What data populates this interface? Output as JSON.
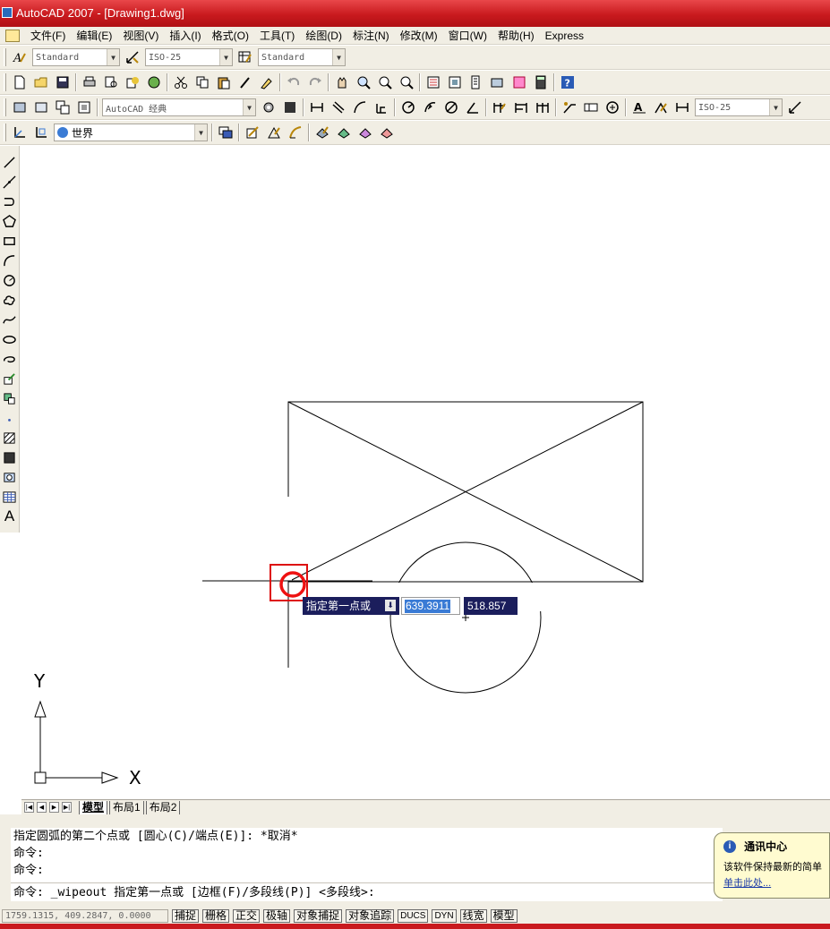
{
  "window": {
    "title": "AutoCAD 2007 - [Drawing1.dwg]"
  },
  "menu": [
    "文件(F)",
    "编辑(E)",
    "视图(V)",
    "插入(I)",
    "格式(O)",
    "工具(T)",
    "绘图(D)",
    "标注(N)",
    "修改(M)",
    "窗口(W)",
    "帮助(H)",
    "Express"
  ],
  "styles_toolbar": {
    "text_style": "Standard",
    "dim_style": "ISO-25",
    "table_style": "Standard"
  },
  "workspace_toolbar": {
    "workspace": "AutoCAD 经典",
    "dim_style": "ISO-25"
  },
  "ucs_toolbar": {
    "ucs": "世界"
  },
  "draw_tools_last": "A",
  "dynamic_input": {
    "prompt": "指定第一点或",
    "x_value": "639.3911",
    "y_value": "518.857"
  },
  "ucs_icon": {
    "x_label": "X",
    "y_label": "Y"
  },
  "layout_tabs": [
    "模型",
    "布局1",
    "布局2"
  ],
  "command": {
    "history": [
      "指定圆弧的第二个点或 [圆心(C)/端点(E)]: *取消*",
      "命令:",
      "命令:"
    ],
    "current": "命令: _wipeout 指定第一点或 [边框(F)/多段线(P)] <多段线>:"
  },
  "notification": {
    "title": "通讯中心",
    "body": "该软件保持最新的简单",
    "link": "单击此处..."
  },
  "status": {
    "coords": "1759.1315, 409.2847, 0.0000",
    "toggles": [
      "捕捉",
      "栅格",
      "正交",
      "极轴",
      "对象捕捉",
      "对象追踪",
      "DUCS",
      "DYN",
      "线宽",
      "模型"
    ]
  },
  "colors": {
    "titlebar": "#c91a1e",
    "toolbar_bg": "#f1eee4",
    "dyn_bg": "#1b1e5c",
    "highlight": "#dd1111"
  }
}
